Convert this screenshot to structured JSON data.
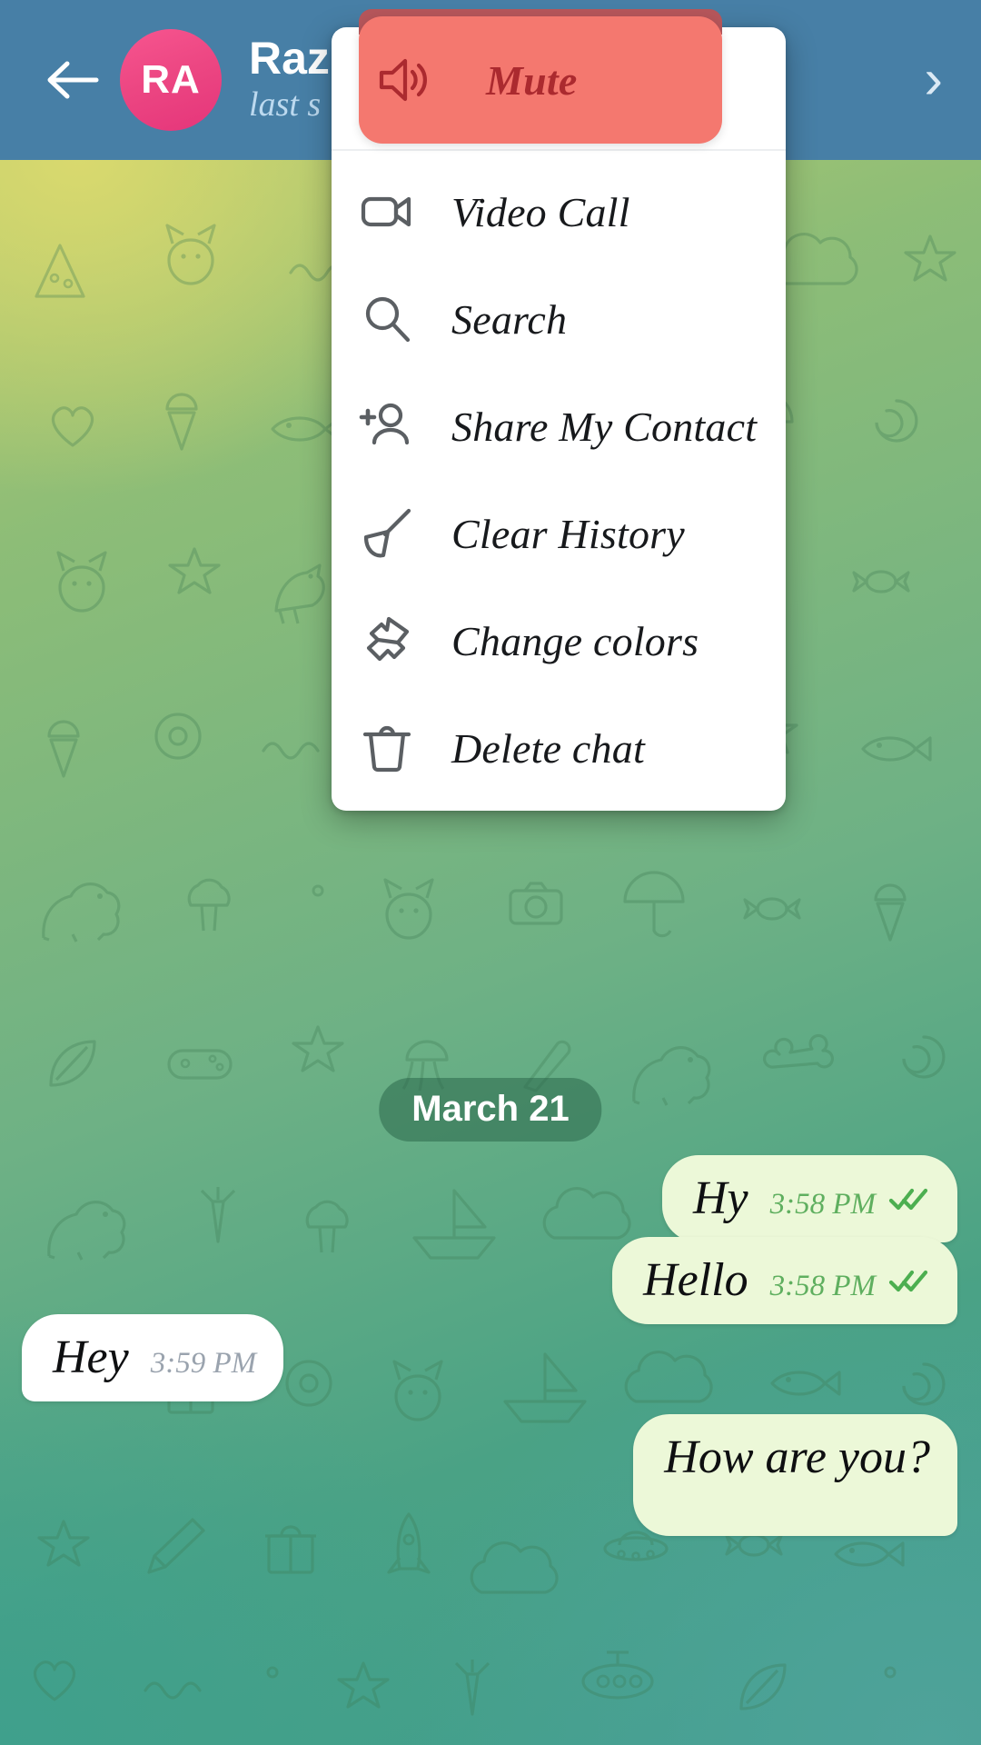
{
  "header": {
    "back_icon": "arrow-left-icon",
    "avatar_initials": "RA",
    "title": "Raz",
    "status": "last s",
    "chevron": "›",
    "background_color": "#477fa6",
    "avatar_color": "#ec4682"
  },
  "menu": {
    "highlight_color": "#f4786f",
    "highlight_text_color": "#ab2a2f",
    "items": [
      {
        "label": "Mute",
        "icon": "speaker-mute-icon",
        "highlighted": true
      },
      {
        "label": "Video Call",
        "icon": "video-camera-icon",
        "highlighted": false
      },
      {
        "label": "Search",
        "icon": "search-icon",
        "highlighted": false
      },
      {
        "label": "Share My Contact",
        "icon": "person-add-icon",
        "highlighted": false
      },
      {
        "label": "Clear History",
        "icon": "broom-icon",
        "highlighted": false
      },
      {
        "label": "Change colors",
        "icon": "paint-brush-icon",
        "highlighted": false
      },
      {
        "label": "Delete chat",
        "icon": "trash-icon",
        "highlighted": false
      }
    ]
  },
  "chat": {
    "date_badge": "March 21",
    "messages": [
      {
        "text": "Hy",
        "time": "3:58 PM",
        "direction": "out",
        "status": "read"
      },
      {
        "text": "Hello",
        "time": "3:58 PM",
        "direction": "out",
        "status": "read"
      },
      {
        "text": "Hey",
        "time": "3:59 PM",
        "direction": "in",
        "status": ""
      },
      {
        "text": "How are you?",
        "time": "",
        "direction": "out",
        "status": ""
      }
    ]
  }
}
